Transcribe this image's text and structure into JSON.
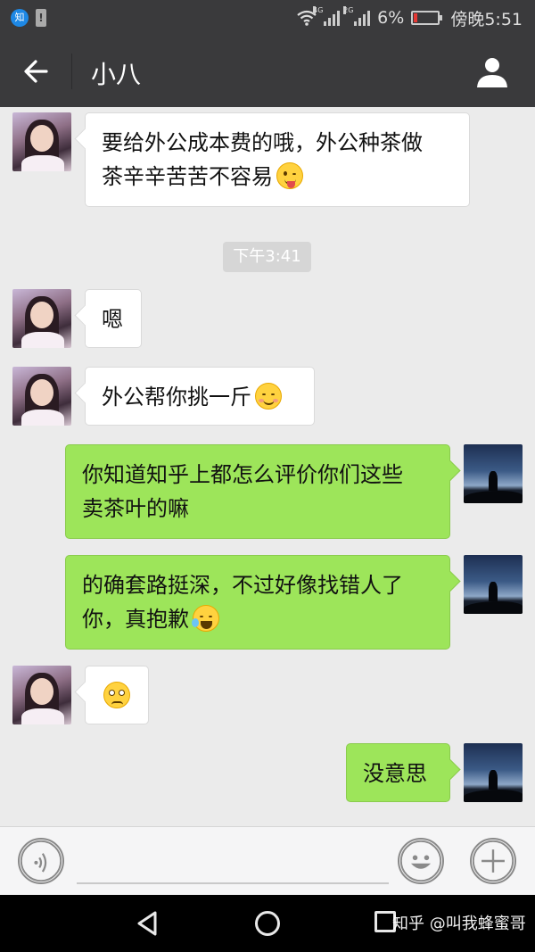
{
  "status_bar": {
    "app_icon": "知",
    "net_4g": "4G",
    "net_2g": "2G",
    "battery": "6%",
    "time": "傍晚5:51"
  },
  "header": {
    "title": "小八"
  },
  "messages": [
    {
      "side": "left",
      "text": "要给外公成本费的哦，外公种茶做\n茶辛辛苦苦不容易",
      "emoji": "winking-tongue-emoji"
    },
    {
      "side": "left",
      "text": "嗯"
    },
    {
      "side": "left",
      "text": "外公帮你挑一斤",
      "emoji": "smiling-blush-emoji"
    },
    {
      "side": "right",
      "text": "你知道知乎上都怎么评价你们这些\n卖茶叶的嘛"
    },
    {
      "side": "right",
      "text": "的确套路挺深，不过好像找错人了\n你，真抱歉",
      "emoji": "laugh-cry-emoji"
    },
    {
      "side": "left",
      "text": "",
      "emoji": "confused-emoji"
    },
    {
      "side": "right",
      "text": "没意思"
    }
  ],
  "time_separator": "下午3:41",
  "watermark": "知乎 @叫我蜂蜜哥"
}
